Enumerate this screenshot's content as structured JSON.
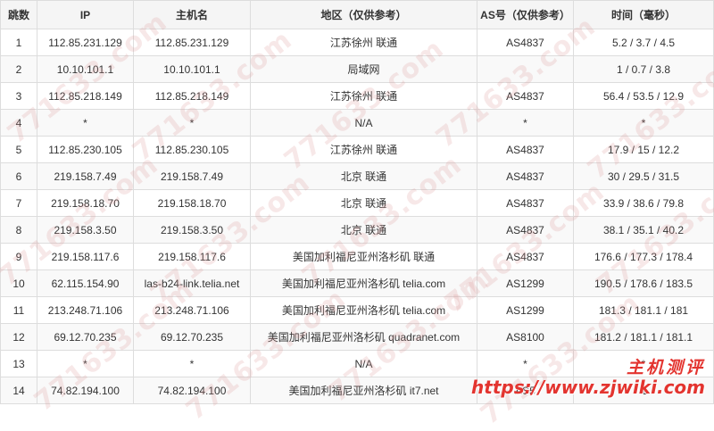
{
  "table": {
    "headers": [
      "跳数",
      "IP",
      "主机名",
      "地区（仅供参考）",
      "AS号（仅供参考）",
      "时间（毫秒）"
    ],
    "rows": [
      {
        "hop": "1",
        "ip": "112.85.231.129",
        "host": "112.85.231.129",
        "region": "江苏徐州 联通",
        "as": "AS4837",
        "time": "5.2 / 3.7 / 4.5"
      },
      {
        "hop": "2",
        "ip": "10.10.101.1",
        "host": "10.10.101.1",
        "region": "局域网",
        "as": "",
        "time": "1 / 0.7 / 3.8"
      },
      {
        "hop": "3",
        "ip": "112.85.218.149",
        "host": "112.85.218.149",
        "region": "江苏徐州 联通",
        "as": "AS4837",
        "time": "56.4 / 53.5 / 12.9"
      },
      {
        "hop": "4",
        "ip": "*",
        "host": "*",
        "region": "N/A",
        "as": "*",
        "time": "*"
      },
      {
        "hop": "5",
        "ip": "112.85.230.105",
        "host": "112.85.230.105",
        "region": "江苏徐州 联通",
        "as": "AS4837",
        "time": "17.9 / 15 / 12.2"
      },
      {
        "hop": "6",
        "ip": "219.158.7.49",
        "host": "219.158.7.49",
        "region": "北京 联通",
        "as": "AS4837",
        "time": "30 / 29.5 / 31.5"
      },
      {
        "hop": "7",
        "ip": "219.158.18.70",
        "host": "219.158.18.70",
        "region": "北京 联通",
        "as": "AS4837",
        "time": "33.9 / 38.6 / 79.8"
      },
      {
        "hop": "8",
        "ip": "219.158.3.50",
        "host": "219.158.3.50",
        "region": "北京 联通",
        "as": "AS4837",
        "time": "38.1 / 35.1 / 40.2"
      },
      {
        "hop": "9",
        "ip": "219.158.117.6",
        "host": "219.158.117.6",
        "region": "美国加利福尼亚州洛杉矶 联通",
        "as": "AS4837",
        "time": "176.6 / 177.3 / 178.4"
      },
      {
        "hop": "10",
        "ip": "62.115.154.90",
        "host": "las-b24-link.telia.net",
        "region": "美国加利福尼亚州洛杉矶 telia.com",
        "as": "AS1299",
        "time": "190.5 / 178.6 / 183.5"
      },
      {
        "hop": "11",
        "ip": "213.248.71.106",
        "host": "213.248.71.106",
        "region": "美国加利福尼亚州洛杉矶 telia.com",
        "as": "AS1299",
        "time": "181.3 / 181.1 / 181"
      },
      {
        "hop": "12",
        "ip": "69.12.70.235",
        "host": "69.12.70.235",
        "region": "美国加利福尼亚州洛杉矶 quadranet.com",
        "as": "AS8100",
        "time": "181.2 / 181.1 / 181.1"
      },
      {
        "hop": "13",
        "ip": "*",
        "host": "*",
        "region": "N/A",
        "as": "*",
        "time": "*"
      },
      {
        "hop": "14",
        "ip": "74.82.194.100",
        "host": "74.82.194.100",
        "region": "美国加利福尼亚州洛杉矶 it7.net",
        "as": "AS5",
        "time": "1"
      }
    ]
  },
  "watermark": {
    "text": "771633.com",
    "brand_title": "主机测评",
    "brand_url": "https://www.zjwiki.com"
  },
  "colors": {
    "link": "#337ab7",
    "header_bg": "#f5f5f5",
    "border": "#dddddd",
    "brand": "#e3342f"
  }
}
